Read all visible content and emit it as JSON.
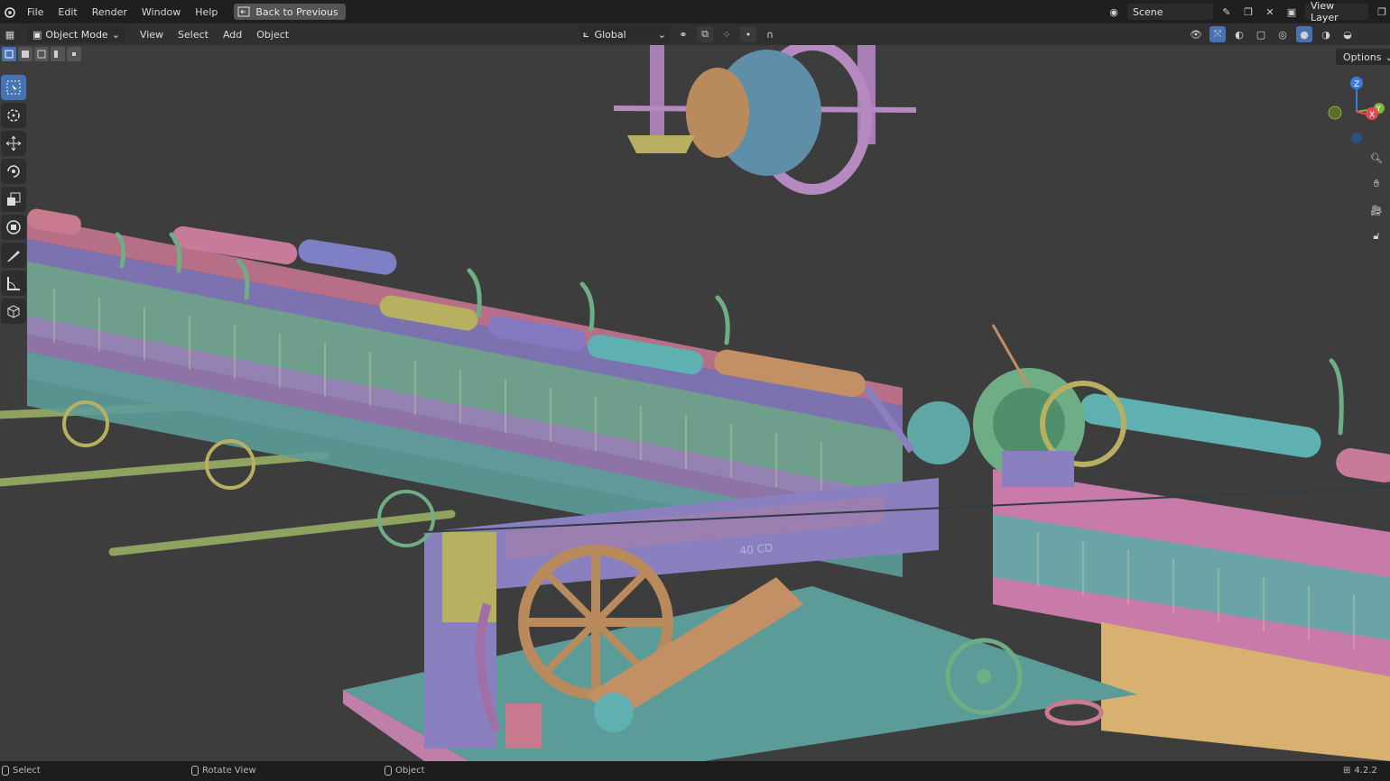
{
  "topbar": {
    "menu": [
      "File",
      "Edit",
      "Render",
      "Window",
      "Help"
    ],
    "back_button": "Back to Previous",
    "scene_label": "Scene",
    "view_layer_label": "View Layer"
  },
  "header": {
    "mode": "Object Mode",
    "menu": [
      "View",
      "Select",
      "Add",
      "Object"
    ],
    "transform_orientation": "Global"
  },
  "viewport": {
    "options_label": "Options",
    "gizmo_axes": {
      "z": "Z",
      "y": "Y",
      "x": "X"
    },
    "machine_marking": "40 CD"
  },
  "status": {
    "select": "Select",
    "rotate": "Rotate View",
    "object": "Object",
    "version": "4.2.2"
  },
  "colors": {
    "accent": "#4772b3",
    "teal": "#5fa8a6",
    "pink": "#c2789b",
    "olive": "#a8a85a",
    "tan": "#b98a5b",
    "lavender": "#8a80bf",
    "green": "#6fae84"
  }
}
